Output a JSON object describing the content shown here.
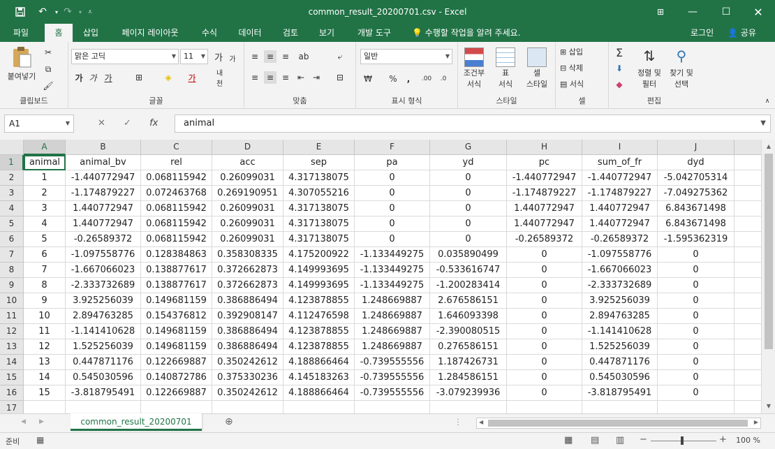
{
  "window": {
    "title": "common_result_20200701.csv - Excel",
    "qa_icons": [
      "save-icon",
      "undo-icon",
      "redo-icon",
      "customize-icon"
    ]
  },
  "tabs": [
    "파일",
    "홈",
    "삽입",
    "페이지 레이아웃",
    "수식",
    "데이터",
    "검토",
    "보기",
    "개발 도구"
  ],
  "active_tab": "홈",
  "tell_me": "수행할 작업을 알려 주세요.",
  "login_label": "로그인",
  "share_label": "공유",
  "ribbon": {
    "clipboard": {
      "label": "클립보드",
      "paste": "붙여넣기"
    },
    "font": {
      "label": "글꼴",
      "name": "맑은 고딕",
      "size": "11",
      "grow": "가",
      "shrink": "가",
      "bold": "가",
      "italic": "가",
      "underline": "가",
      "phonetic": "내천"
    },
    "alignment": {
      "label": "맞춤"
    },
    "number": {
      "label": "표시 형식",
      "format": "일반"
    },
    "styles": {
      "label": "스타일",
      "conditional": "조건부",
      "conditional2": "서식",
      "table": "표",
      "table2": "서식",
      "cell_styles": "셀",
      "cell_styles2": "스타일"
    },
    "cells": {
      "label": "셀",
      "insert": "삽입",
      "delete": "삭제",
      "format": "서식"
    },
    "editing": {
      "label": "편집",
      "sort": "정렬 및",
      "sort2": "필터",
      "find": "찾기 및",
      "find2": "선택"
    }
  },
  "formula_bar": {
    "name_box": "A1",
    "fx": "fx",
    "value": "animal"
  },
  "columns": [
    {
      "letter": "A",
      "header": "animal"
    },
    {
      "letter": "B",
      "header": "animal_bv"
    },
    {
      "letter": "C",
      "header": "rel"
    },
    {
      "letter": "D",
      "header": "acc"
    },
    {
      "letter": "E",
      "header": "sep"
    },
    {
      "letter": "F",
      "header": "pa"
    },
    {
      "letter": "G",
      "header": "yd"
    },
    {
      "letter": "H",
      "header": "pc"
    },
    {
      "letter": "I",
      "header": "sum_of_fr"
    },
    {
      "letter": "J",
      "header": "dyd"
    }
  ],
  "rows": [
    [
      "1",
      "-1.440772947",
      "0.068115942",
      "0.26099031",
      "4.317138075",
      "0",
      "0",
      "-1.440772947",
      "-1.440772947",
      "-5.042705314"
    ],
    [
      "2",
      "-1.174879227",
      "0.072463768",
      "0.269190951",
      "4.307055216",
      "0",
      "0",
      "-1.174879227",
      "-1.174879227",
      "-7.049275362"
    ],
    [
      "3",
      "1.440772947",
      "0.068115942",
      "0.26099031",
      "4.317138075",
      "0",
      "0",
      "1.440772947",
      "1.440772947",
      "6.843671498"
    ],
    [
      "4",
      "1.440772947",
      "0.068115942",
      "0.26099031",
      "4.317138075",
      "0",
      "0",
      "1.440772947",
      "1.440772947",
      "6.843671498"
    ],
    [
      "5",
      "-0.26589372",
      "0.068115942",
      "0.26099031",
      "4.317138075",
      "0",
      "0",
      "-0.26589372",
      "-0.26589372",
      "-1.595362319"
    ],
    [
      "6",
      "-1.097558776",
      "0.128384863",
      "0.358308335",
      "4.175200922",
      "-1.133449275",
      "0.035890499",
      "0",
      "-1.097558776",
      "0"
    ],
    [
      "7",
      "-1.667066023",
      "0.138877617",
      "0.372662873",
      "4.149993695",
      "-1.133449275",
      "-0.533616747",
      "0",
      "-1.667066023",
      "0"
    ],
    [
      "8",
      "-2.333732689",
      "0.138877617",
      "0.372662873",
      "4.149993695",
      "-1.133449275",
      "-1.200283414",
      "0",
      "-2.333732689",
      "0"
    ],
    [
      "9",
      "3.925256039",
      "0.149681159",
      "0.386886494",
      "4.123878855",
      "1.248669887",
      "2.676586151",
      "0",
      "3.925256039",
      "0"
    ],
    [
      "10",
      "2.894763285",
      "0.154376812",
      "0.392908147",
      "4.112476598",
      "1.248669887",
      "1.646093398",
      "0",
      "2.894763285",
      "0"
    ],
    [
      "11",
      "-1.141410628",
      "0.149681159",
      "0.386886494",
      "4.123878855",
      "1.248669887",
      "-2.390080515",
      "0",
      "-1.141410628",
      "0"
    ],
    [
      "12",
      "1.525256039",
      "0.149681159",
      "0.386886494",
      "4.123878855",
      "1.248669887",
      "0.276586151",
      "0",
      "1.525256039",
      "0"
    ],
    [
      "13",
      "0.447871176",
      "0.122669887",
      "0.350242612",
      "4.188866464",
      "-0.739555556",
      "1.187426731",
      "0",
      "0.447871176",
      "0"
    ],
    [
      "14",
      "0.545030596",
      "0.140872786",
      "0.375330236",
      "4.145183263",
      "-0.739555556",
      "1.284586151",
      "0",
      "0.545030596",
      "0"
    ],
    [
      "15",
      "-3.818795491",
      "0.122669887",
      "0.350242612",
      "4.188866464",
      "-0.739555556",
      "-3.079239936",
      "0",
      "-3.818795491",
      "0"
    ]
  ],
  "row_numbers": [
    "1",
    "2",
    "3",
    "4",
    "5",
    "6",
    "7",
    "8",
    "9",
    "10",
    "11",
    "12",
    "13",
    "14",
    "15",
    "16",
    "17"
  ],
  "sheet_tab": "common_result_20200701",
  "status": {
    "ready": "준비",
    "zoom": "100 %"
  },
  "colors": {
    "accent": "#217346"
  }
}
